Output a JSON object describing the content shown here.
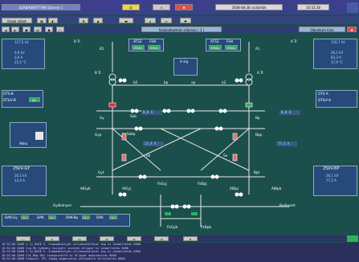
{
  "title_bar": {
    "app_title": "SZABADBATTYÁN Szerver 1",
    "date": "2008-08-28 csütörtök",
    "time": "10:52:28"
  },
  "toolbar2": {
    "left_label": "Hazai nézet",
    "center_label": "Szabadbattyán állomás ( 1 )",
    "right_label": "Objektum lista"
  },
  "transformers": {
    "left": {
      "name": "B Tr.",
      "u1": "127,5 kV",
      "u2": "0,0 kV",
      "i": "0,0 A",
      "t": "25,5 °C"
    },
    "right": {
      "name": "A Tr.",
      "u1": "126,7 kV",
      "u2": "26,1 kV",
      "i": "83,3 A",
      "t": "37,9 °C"
    }
  },
  "atsz_left": {
    "h1": "ATSZ",
    "h2": "FHA",
    "b1": "fűtés",
    "b2": "fűtés"
  },
  "atsz_right": {
    "h1": "ATSZ",
    "h2": "FHA",
    "b1": "fűtés",
    "b2": "fűtés"
  },
  "sig_box": {
    "label": "S sig"
  },
  "dts_left": {
    "l1": "DTS-B",
    "l2": "DT&V-B",
    "tag": "Ny"
  },
  "dts_right": {
    "l1": "DTS-A",
    "l2": "DT&V-A"
  },
  "akku": {
    "label": "Akku"
  },
  "bus_left": {
    "name": "25kV-GY",
    "v1": "26,1 kV",
    "v2": "13,4 A"
  },
  "bus_right": {
    "name": "25kV-BP",
    "v1": "26,1 kV",
    "v2": "77,2 A"
  },
  "measure_values": {
    "m1": "0,0 A",
    "m2": "13,4 A",
    "m3": "77,2 A",
    "m4": "0,0 A"
  },
  "node_labels": {
    "b1": "B1",
    "b2": "b2",
    "bp": "bp",
    "ap": "ap",
    "a2": "a2",
    "a1": "A1",
    "btr": "B Tr.",
    "atr": "A Tr.",
    "k1": "k1",
    "kb": "k1",
    "gy": "Gy",
    "gyb": "Gyp",
    "sab": "Sab",
    "sabp": "Sabp",
    "bp2": "Bp",
    "bpp": "Bpp",
    "sb": "Sb",
    "sa": "Sa",
    "gyt": "Gyt",
    "bpt": "Bpt",
    "aigyb": "AIGyb",
    "aigyj": "AIGyj",
    "fkgyj": "FkGyj",
    "fkbpj": "FkBpj",
    "aibpj": "AIBpj",
    "aibpb": "AIBpb",
    "fkgyb": "FkGyb",
    "fkbpb": "FkBpb",
    "left_end": "Gyékényes",
    "right_end": "Budapest"
  },
  "status_strip": [
    {
      "label": "DAK-Gy",
      "val": "9s"
    },
    {
      "label": "DAK",
      "val": "9s"
    },
    {
      "label": "DAK-Bp",
      "val": "9s"
    },
    {
      "label": "DAK",
      "val": "9s"
    }
  ],
  "log_lines": [
    "10:52:00 DAKB a ty_DOS6   5. Szabadbattyán villamoshálózat tmp ki üzemeltetés  0000",
    "10:52:00 DAKB Sig_9b  Gyékény Szolgált vezeték állapot  ki üzemeltetés  0000",
    "10:52:00 DAKB a ty_DOS6   5. Szabadbattyán villamoshálózat tmp ki üzemeltetés  0000",
    "10:52:00 DAKB Fűt_Nag DK1 ívmegszakító ki állapot megszakítás  0000",
    "10:52:00 DAKB Fokozat: PP1 tápág megmutatva változásra túlterhelés  0000"
  ],
  "colors": {
    "background": "#1b4f4c",
    "bus_line": "#e8e8e8",
    "alarm_red": "#e03030",
    "ok_green": "#2fb05a",
    "panel_blue": "#274a7a"
  }
}
